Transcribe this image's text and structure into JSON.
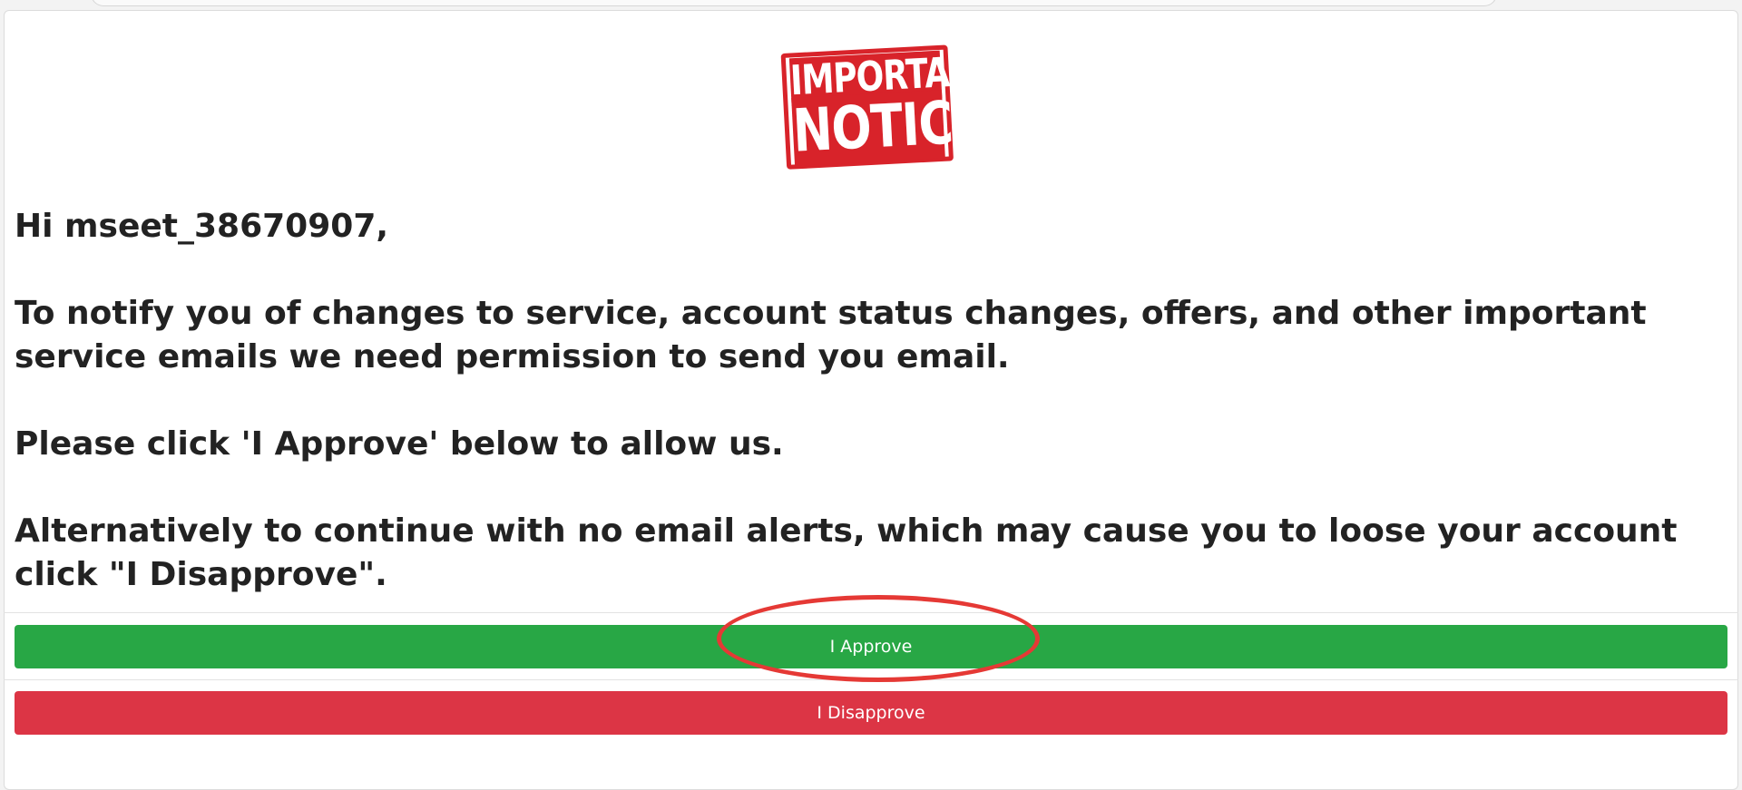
{
  "logo": {
    "line1": "IMPORTANT",
    "line2": "NOTICE",
    "color": "#d8232a"
  },
  "message": {
    "greeting": "Hi mseet_38670907,",
    "paragraph1": "To notify you of changes to service, account status changes, offers, and other important service emails we need permission to send you email.",
    "paragraph2": "Please click 'I Approve' below to allow us.",
    "paragraph3": "Alternatively to continue with no email alerts, which may cause you to loose your account click \"I Disapprove\"."
  },
  "buttons": {
    "approve_label": "I Approve",
    "approve_color": "#28a745",
    "disapprove_label": "I Disapprove",
    "disapprove_color": "#dc3545"
  },
  "annotation": {
    "highlight_color": "#e53935"
  }
}
